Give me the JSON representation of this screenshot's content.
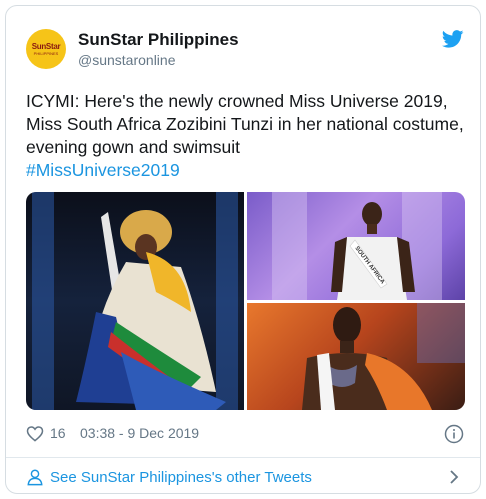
{
  "account": {
    "name": "SunStar Philippines",
    "handle": "@sunstaronline",
    "avatar_line1": "SunStar",
    "avatar_line2": "PHILIPPINES",
    "avatar_color": "#f6c418"
  },
  "tweet": {
    "text": "ICYMI: Here's the newly crowned Miss Universe 2019, Miss South Africa Zozibini Tunzi in her national costume, evening gown and swimsuit",
    "hashtag": "#MissUniverse2019",
    "sash_text": "SOUTH AFRICA"
  },
  "meta": {
    "likes": "16",
    "timestamp": "03:38 - 9 Dec 2019"
  },
  "footer": {
    "link_text": "See SunStar Philippines's other Tweets"
  },
  "colors": {
    "link": "#1b95e0",
    "secondary_text": "#657786",
    "twitter_blue": "#1da1f2"
  },
  "icons": [
    "twitter-bird-icon",
    "heart-icon",
    "info-icon",
    "person-icon",
    "chevron-right-icon"
  ]
}
